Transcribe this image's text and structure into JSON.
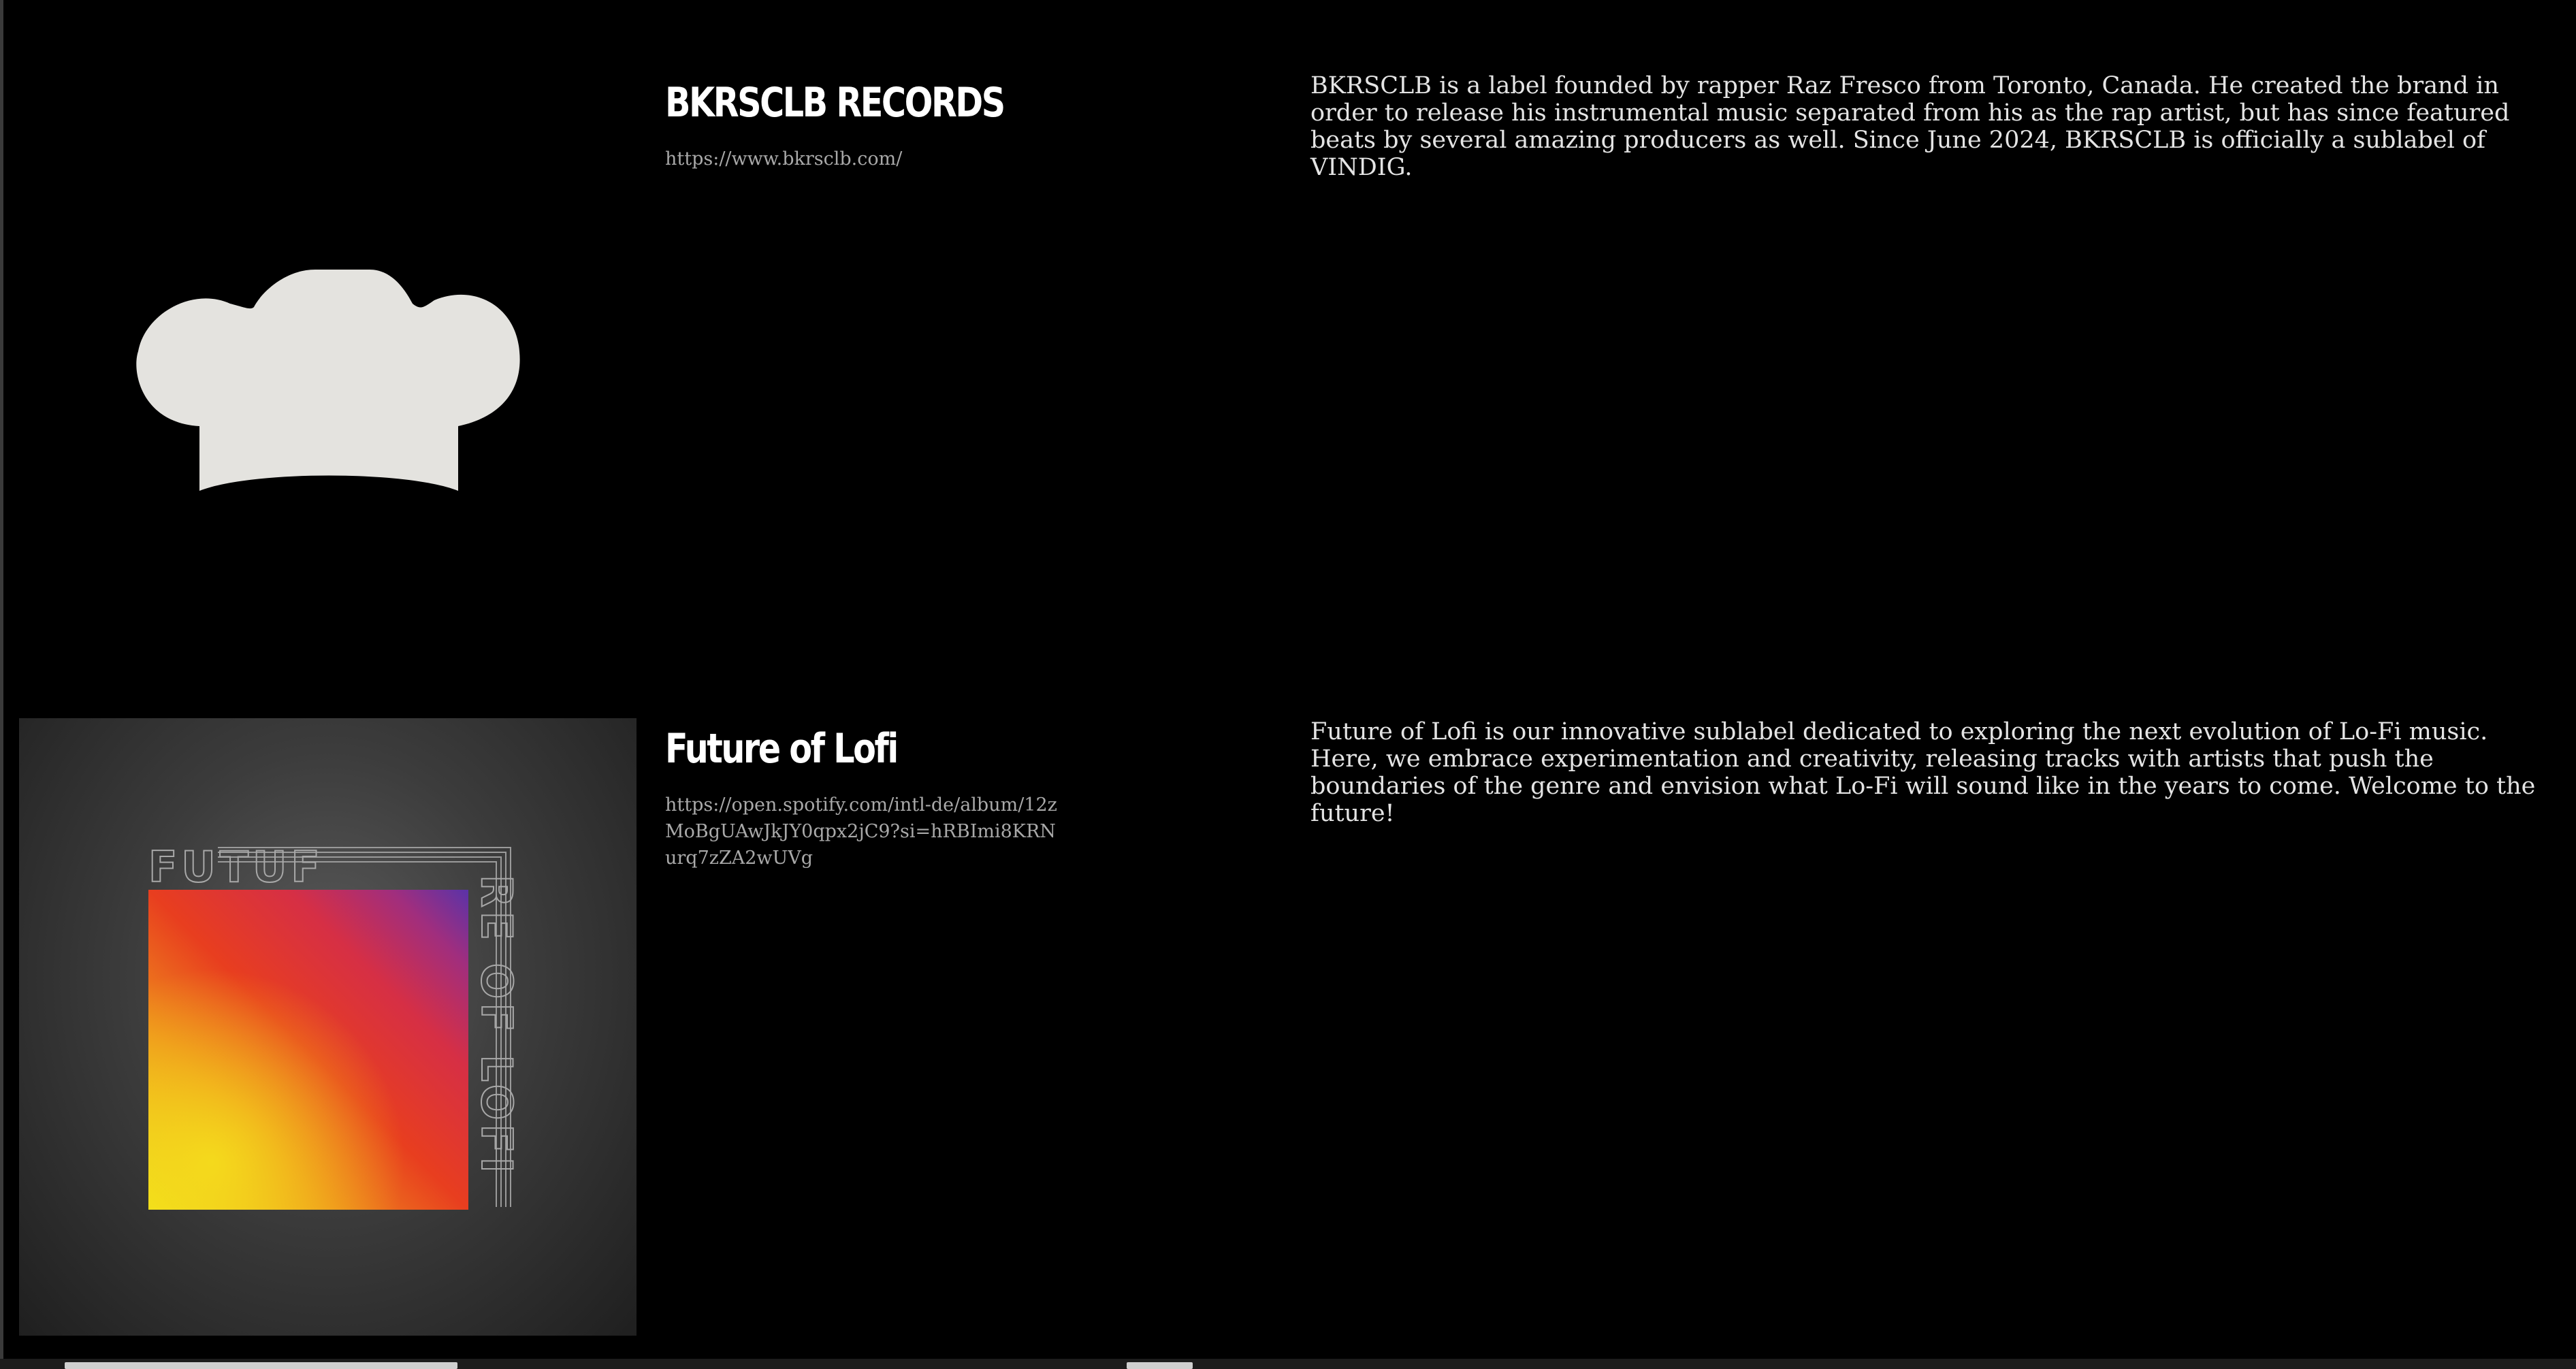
{
  "labels": [
    {
      "name": "BKRSCLB RECORDS",
      "url": "https://www.bkrsclb.com/",
      "description": "BKRSCLB is a label founded by rapper Raz Fresco from Toronto, Canada. He created the brand in order to release his instrumental music separated from his as the rap artist, but has since featured beats by several amazing producers as well. Since June 2024, BKRSCLB is officially a sublabel of VINDIG.",
      "artwork_icon": "chef-hat-icon"
    },
    {
      "name": "Future of Lofi",
      "url": "https://open.spotify.com/intl-de/album/12zMoBgUAwJkJY0qpx2jC9?si=hRBImi8KRNurq7zZA2wUVg",
      "description": "Future of Lofi is our innovative sublabel dedicated to exploring the next evolution of Lo-Fi music. Here, we embrace experimentation and creativity, releasing tracks with artists that push the boundaries of the genre and envision what Lo-Fi will sound like in the years to come. Welcome to the future!",
      "artwork_text_top": "FUTUF",
      "artwork_text_side": "RE OF LOFI",
      "artwork_colors": [
        "#f0dd1a",
        "#e83e1f",
        "#e8322a",
        "#c72d6a",
        "#5a33a8"
      ]
    }
  ],
  "colors": {
    "background": "#000000",
    "heading": "#ffffff",
    "url": "#a9a9a9",
    "body_text": "#e4e4e4",
    "hat": "#e4e3df"
  }
}
